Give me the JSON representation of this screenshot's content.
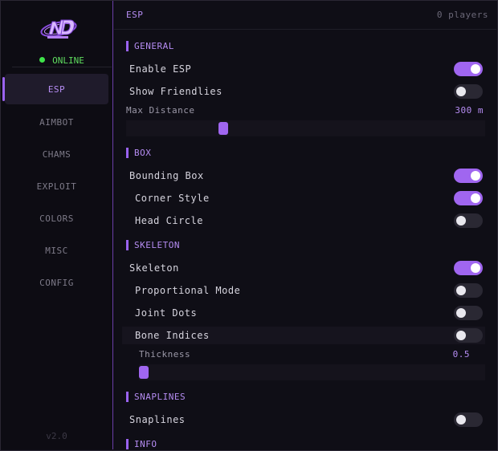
{
  "sidebar": {
    "status": "ONLINE",
    "nav": [
      "ESP",
      "AIMBOT",
      "CHAMS",
      "EXPLOIT",
      "COLORS",
      "MISC",
      "CONFIG"
    ],
    "active": "ESP",
    "version": "v2.0"
  },
  "header": {
    "title": "ESP",
    "players": "0 players"
  },
  "general": {
    "title": "GENERAL",
    "enable_esp": {
      "label": "Enable ESP",
      "on": true
    },
    "show_friendlies": {
      "label": "Show Friendlies",
      "on": false
    },
    "max_distance": {
      "label": "Max Distance",
      "value_text": "300 m",
      "fraction": 0.27
    }
  },
  "box": {
    "title": "BOX",
    "bounding_box": {
      "label": "Bounding Box",
      "on": true
    },
    "corner_style": {
      "label": "Corner Style",
      "on": true
    },
    "head_circle": {
      "label": "Head Circle",
      "on": false
    }
  },
  "skeleton": {
    "title": "SKELETON",
    "skeleton": {
      "label": "Skeleton",
      "on": true
    },
    "proportional_mode": {
      "label": "Proportional Mode",
      "on": false
    },
    "joint_dots": {
      "label": "Joint Dots",
      "on": false
    },
    "bone_indices": {
      "label": "Bone Indices",
      "on": false
    },
    "thickness": {
      "label": "Thickness",
      "value_text": "0.5",
      "fraction": 0.0
    }
  },
  "snaplines": {
    "title": "SNAPLINES",
    "snaplines": {
      "label": "Snaplines",
      "on": false
    }
  },
  "info": {
    "title": "INFO"
  },
  "colors": {
    "accent": "#a066f0",
    "online": "#3fe34a",
    "toggle_off": "#2a2833"
  }
}
